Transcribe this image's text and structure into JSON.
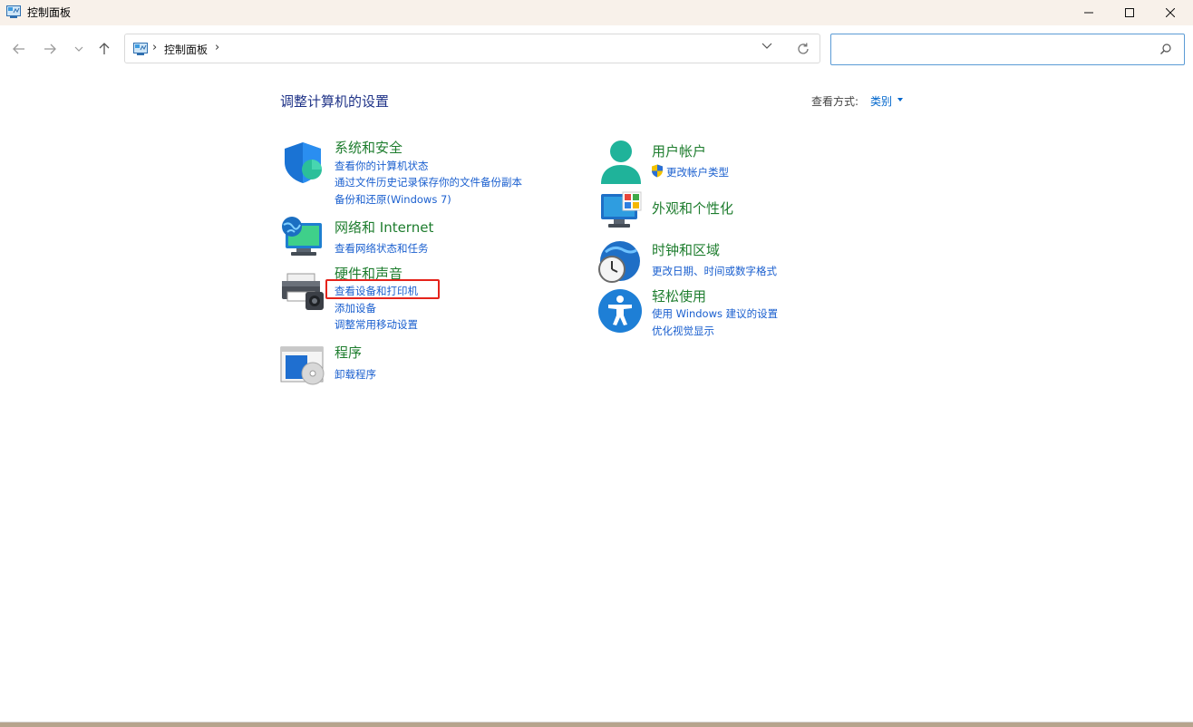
{
  "window": {
    "title": "控制面板"
  },
  "address": {
    "crumb": "控制面板",
    "search_placeholder": ""
  },
  "main": {
    "heading": "调整计算机的设置",
    "view_by_label": "查看方式:",
    "view_by_value": "类别"
  },
  "categories": {
    "system_security": {
      "title": "系统和安全",
      "links": [
        "查看你的计算机状态",
        "通过文件历史记录保存你的文件备份副本",
        "备份和还原(Windows 7)"
      ]
    },
    "network": {
      "title": "网络和 Internet",
      "links": [
        "查看网络状态和任务"
      ]
    },
    "hardware": {
      "title": "硬件和声音",
      "links": [
        "查看设备和打印机",
        "添加设备",
        "调整常用移动设置"
      ]
    },
    "programs": {
      "title": "程序",
      "links": [
        "卸载程序"
      ]
    },
    "user_accounts": {
      "title": "用户帐户",
      "links": [
        "更改帐户类型"
      ]
    },
    "appearance": {
      "title": "外观和个性化",
      "links": []
    },
    "clock_region": {
      "title": "时钟和区域",
      "links": [
        "更改日期、时间或数字格式"
      ]
    },
    "ease_of_access": {
      "title": "轻松使用",
      "links": [
        "使用 Windows 建议的设置",
        "优化视觉显示"
      ]
    }
  },
  "colors": {
    "category_title": "#1e7d2e",
    "link": "#1a5fcf",
    "heading": "#1e3287",
    "highlight": "#e5231b"
  }
}
